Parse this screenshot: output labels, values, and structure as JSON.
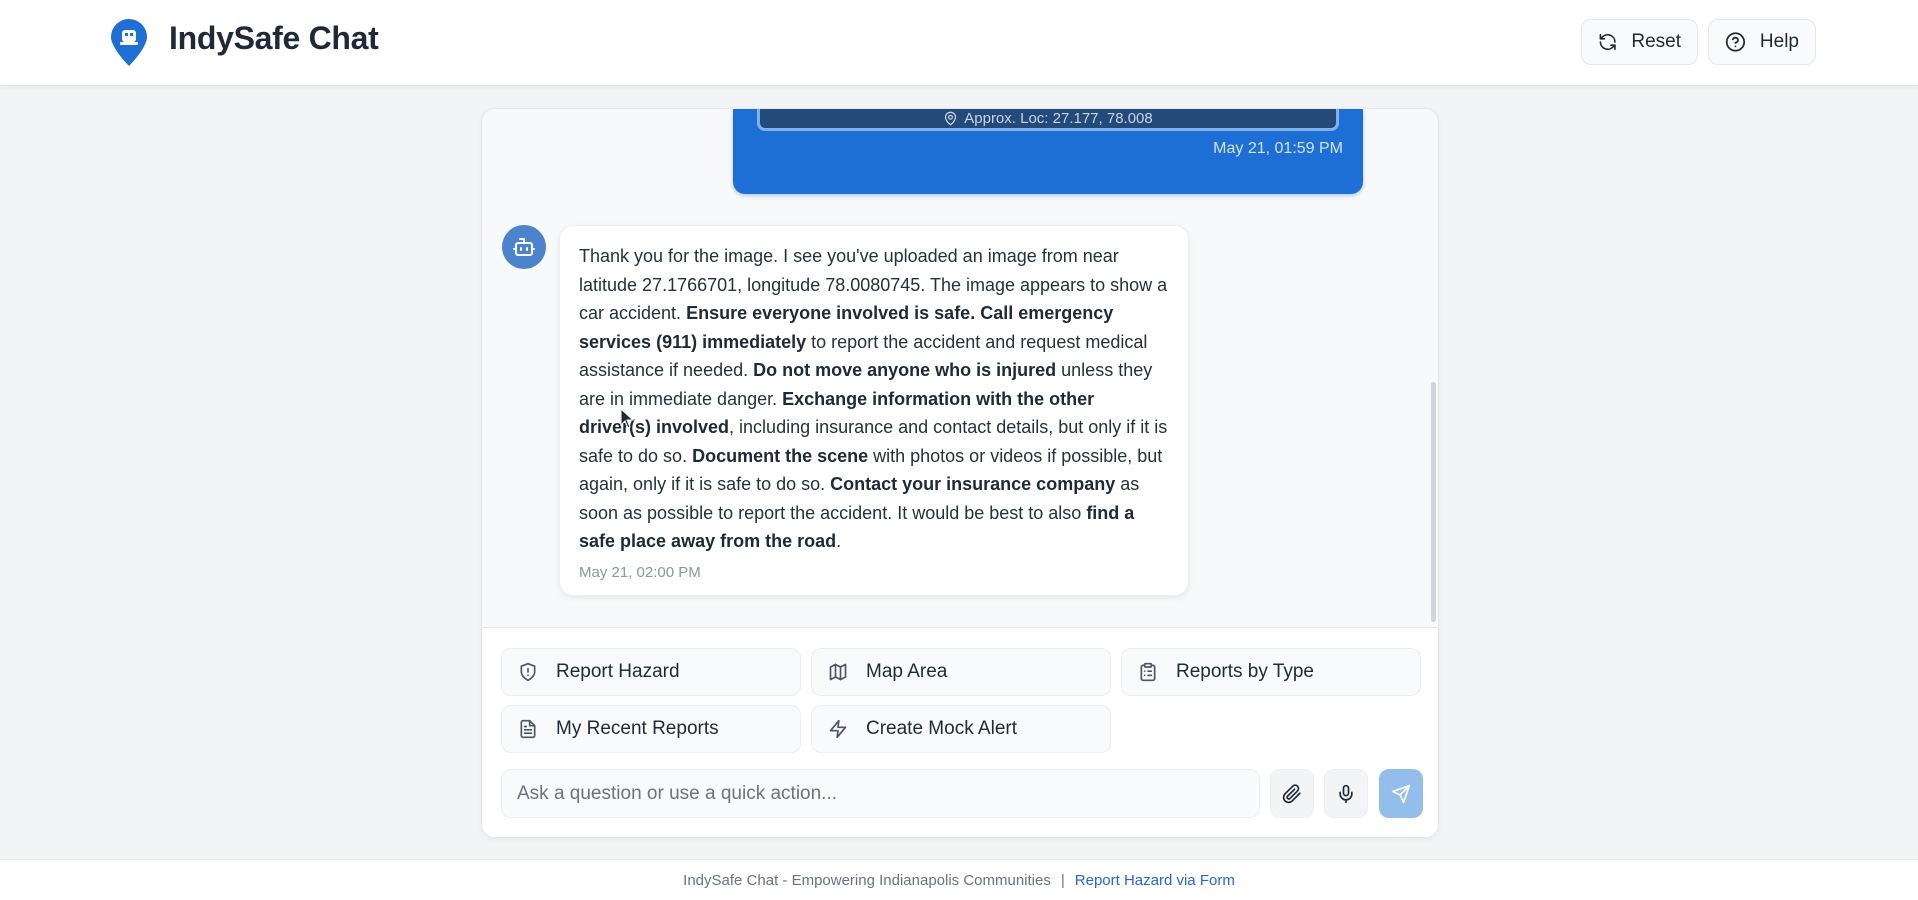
{
  "header": {
    "title": "IndySafe Chat",
    "reset_label": "Reset",
    "help_label": "Help"
  },
  "messages": {
    "user": {
      "location_label": "Approx. Loc: 27.177, 78.008",
      "time": "May 21, 01:59 PM"
    },
    "bot": {
      "segments": [
        {
          "text": "Thank you for the image. I see you've uploaded an image from near latitude 27.1766701, longitude 78.0080745. The image appears to show a car accident. ",
          "bold": false
        },
        {
          "text": "Ensure everyone involved is safe. Call emergency services (911) immediately",
          "bold": true
        },
        {
          "text": " to report the accident and request medical assistance if needed. ",
          "bold": false
        },
        {
          "text": "Do not move anyone who is injured",
          "bold": true
        },
        {
          "text": " unless they are in immediate danger. ",
          "bold": false
        },
        {
          "text": "Exchange information with the other driver(s) involved",
          "bold": true
        },
        {
          "text": ", including insurance and contact details, but only if it is safe to do so. ",
          "bold": false
        },
        {
          "text": "Document the scene",
          "bold": true
        },
        {
          "text": " with photos or videos if possible, but again, only if it is safe to do so. ",
          "bold": false
        },
        {
          "text": "Contact your insurance company",
          "bold": true
        },
        {
          "text": " as soon as possible to report the accident. It would be best to also ",
          "bold": false
        },
        {
          "text": "find a safe place away from the road",
          "bold": true
        },
        {
          "text": ".",
          "bold": false
        }
      ],
      "time": "May 21, 02:00 PM"
    }
  },
  "quick_actions": {
    "report_hazard": "Report Hazard",
    "map_area": "Map Area",
    "reports_by_type": "Reports by Type",
    "my_recent_reports": "My Recent Reports",
    "create_mock_alert": "Create Mock Alert"
  },
  "input": {
    "placeholder": "Ask a question or use a quick action...",
    "value": ""
  },
  "footer": {
    "text": "IndySafe Chat - Empowering Indianapolis Communities",
    "separator": "|",
    "link": "Report Hazard via Form"
  },
  "colors": {
    "brand_blue": "#1d6fd6",
    "send_button": "#93bdea",
    "link": "#2563eb"
  }
}
